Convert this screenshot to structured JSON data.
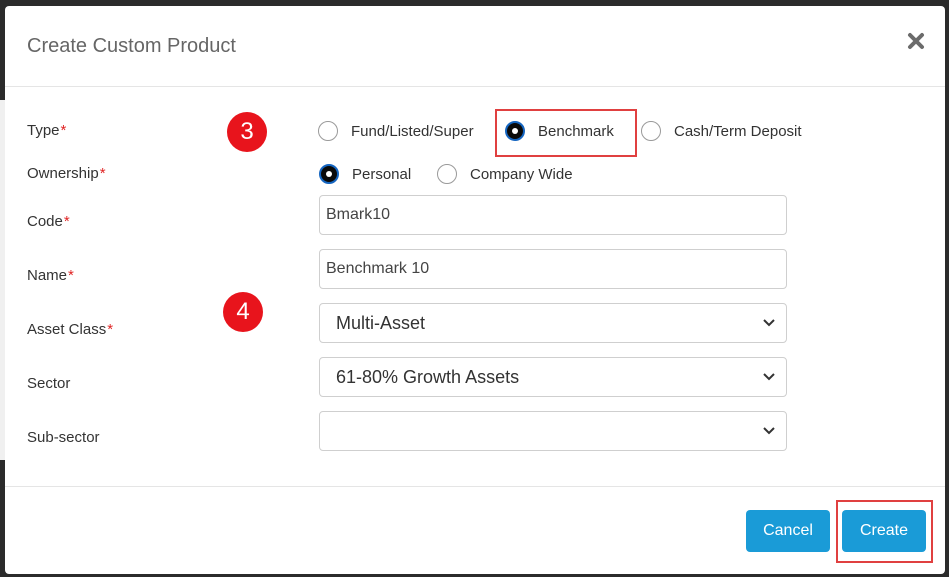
{
  "modal": {
    "title": "Create Custom Product"
  },
  "form": {
    "type": {
      "label": "Type",
      "options": [
        {
          "label": "Fund/Listed/Super",
          "checked": false
        },
        {
          "label": "Benchmark",
          "checked": true
        },
        {
          "label": "Cash/Term Deposit",
          "checked": false
        }
      ]
    },
    "ownership": {
      "label": "Ownership",
      "options": [
        {
          "label": "Personal",
          "checked": true
        },
        {
          "label": "Company Wide",
          "checked": false
        }
      ]
    },
    "code": {
      "label": "Code",
      "value": "Bmark10"
    },
    "name": {
      "label": "Name",
      "value": "Benchmark 10"
    },
    "asset_class": {
      "label": "Asset Class",
      "value": "Multi-Asset"
    },
    "sector": {
      "label": "Sector",
      "value": "61-80% Growth Assets"
    },
    "sub_sector": {
      "label": "Sub-sector",
      "value": ""
    },
    "required_marker": "*"
  },
  "annotations": {
    "step3": "3",
    "step4": "4"
  },
  "footer": {
    "cancel_label": "Cancel",
    "create_label": "Create"
  },
  "colors": {
    "primary_button": "#1a9bd7",
    "required": "#e02424",
    "annotation_badge": "#e8141c",
    "highlight_box": "#e04040"
  },
  "icons": {
    "close": "close-icon",
    "dropdown": "chevron-down-icon"
  }
}
